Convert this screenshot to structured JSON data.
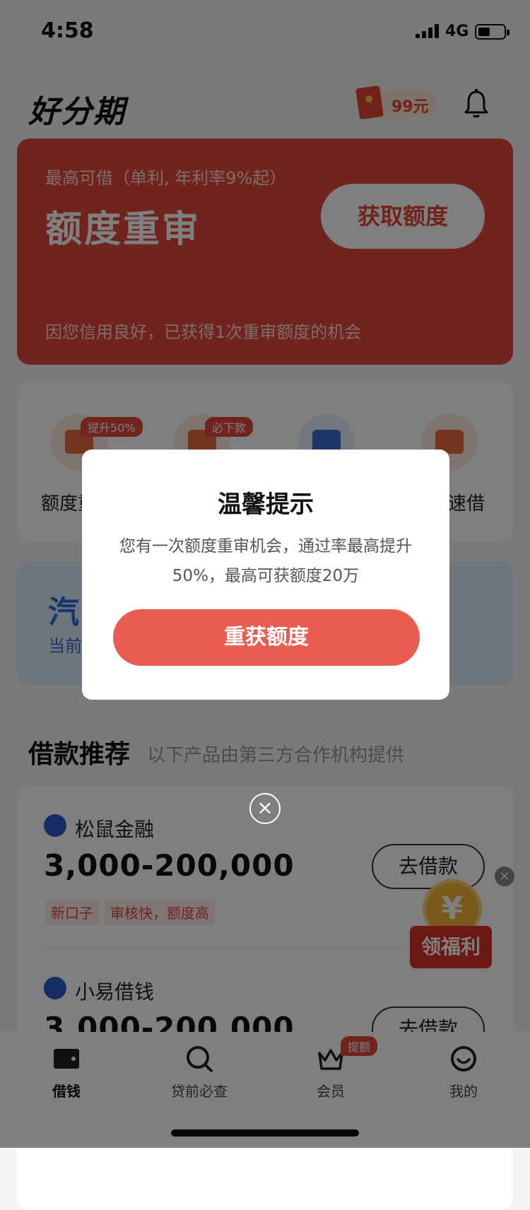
{
  "status_bar": {
    "time": "4:58",
    "network": "4G"
  },
  "header": {
    "logo": "好分期",
    "redpacket_label": "99元",
    "icons": [
      "bell-icon"
    ]
  },
  "hero": {
    "subtitle": "最高可借（单利, 年利率9%起）",
    "title": "额度重审",
    "button": "获取额度",
    "note": "因您信用良好，已获得1次重审额度的机会"
  },
  "quick": {
    "items": [
      {
        "label": "额度重",
        "badge": "提升50%"
      },
      {
        "label": "",
        "badge": "必下款"
      },
      {
        "label": "",
        "badge": ""
      },
      {
        "label": "速借",
        "badge": ""
      }
    ]
  },
  "promo": {
    "title": "汽",
    "subtitle": "当前"
  },
  "recommend": {
    "title": "借款推荐",
    "subtitle": "以下产品由第三方合作机构提供",
    "products": [
      {
        "name": "松鼠金融",
        "amount": "3,000-200,000",
        "tags": [
          "新口子",
          "审核快，额度高"
        ],
        "button": "去借款"
      },
      {
        "name": "小易借钱",
        "amount": "3,000-200,000",
        "tags": [],
        "button": "去借款"
      }
    ]
  },
  "gift": {
    "label": "领福利",
    "coin_symbol": "¥"
  },
  "tabbar": {
    "items": [
      {
        "label": "借钱",
        "icon": "wallet-icon"
      },
      {
        "label": "贷前必查",
        "icon": "search-icon"
      },
      {
        "label": "会员",
        "icon": "crown-icon",
        "badge": "提额"
      },
      {
        "label": "我的",
        "icon": "smile-icon"
      }
    ]
  },
  "modal": {
    "title": "温馨提示",
    "body": "您有一次额度重审机会，通过率最高提升50%，最高可获额度20万",
    "button": "重获额度"
  },
  "colors": {
    "brand_red": "#e3463b",
    "modal_button": "#ea5c50",
    "promo_blue": "#2f6fd4"
  }
}
